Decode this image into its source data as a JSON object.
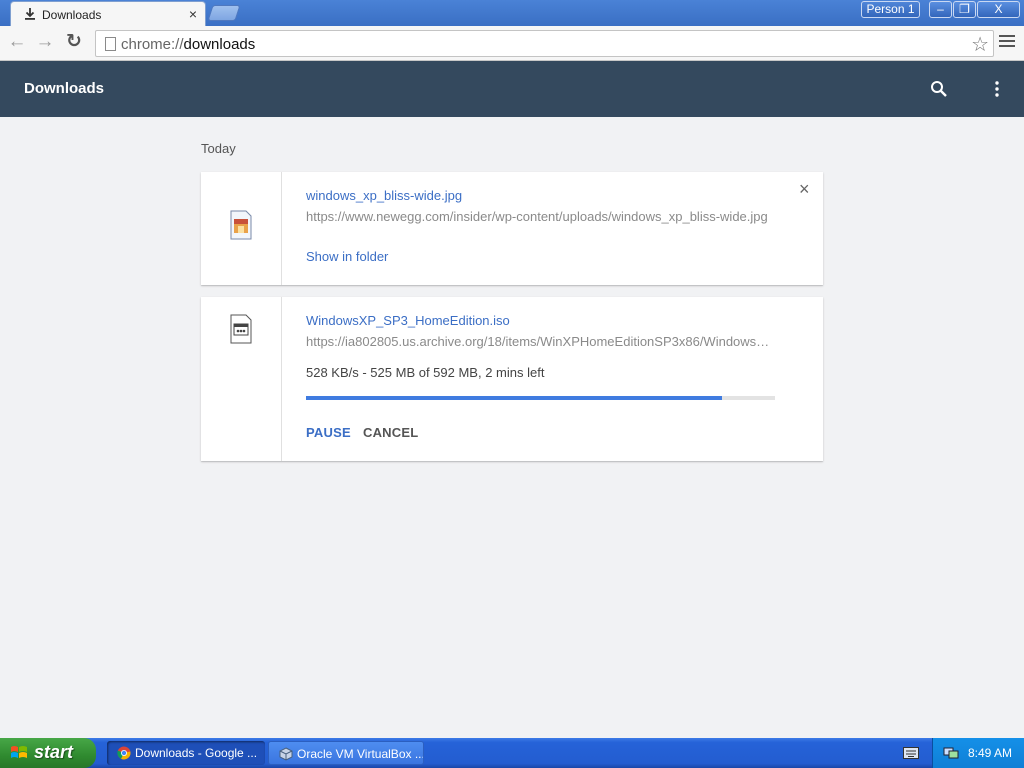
{
  "browser": {
    "tab_title": "Downloads",
    "tab_close": "×",
    "profile_label": "Person 1",
    "window_buttons": {
      "minimize": "–",
      "restore": "❐",
      "close": "X"
    },
    "url_scheme": "chrome://",
    "url_host": "downloads",
    "nav": {
      "back": "←",
      "forward": "→",
      "reload": "↻"
    },
    "star": "☆"
  },
  "header": {
    "title": "Downloads"
  },
  "section": {
    "label": "Today"
  },
  "downloads": [
    {
      "filename": "windows_xp_bliss-wide.jpg",
      "url": "https://www.newegg.com/insider/wp-content/uploads/windows_xp_bliss-wide.jpg",
      "action": "Show in folder",
      "remove": "×"
    },
    {
      "filename": "WindowsXP_SP3_HomeEdition.iso",
      "url": "https://ia802805.us.archive.org/18/items/WinXPHomeEditionSP3x86/WindowsXP…",
      "status": "528 KB/s - 525 MB of 592 MB, 2 mins left",
      "progress_fraction": 0.887,
      "pause_label": "PAUSE",
      "cancel_label": "CANCEL"
    }
  ],
  "colors": {
    "header_bg": "#34495e",
    "link": "#3b6ec5",
    "progress": "#3f7be0",
    "page_bg": "#f1f2f4"
  },
  "taskbar": {
    "start_label": "start",
    "tasks": [
      {
        "label": "Downloads - Google ...",
        "icon": "chrome-icon"
      },
      {
        "label": "Oracle VM VirtualBox ...",
        "icon": "virtualbox-icon"
      }
    ],
    "clock": "8:49 AM"
  }
}
